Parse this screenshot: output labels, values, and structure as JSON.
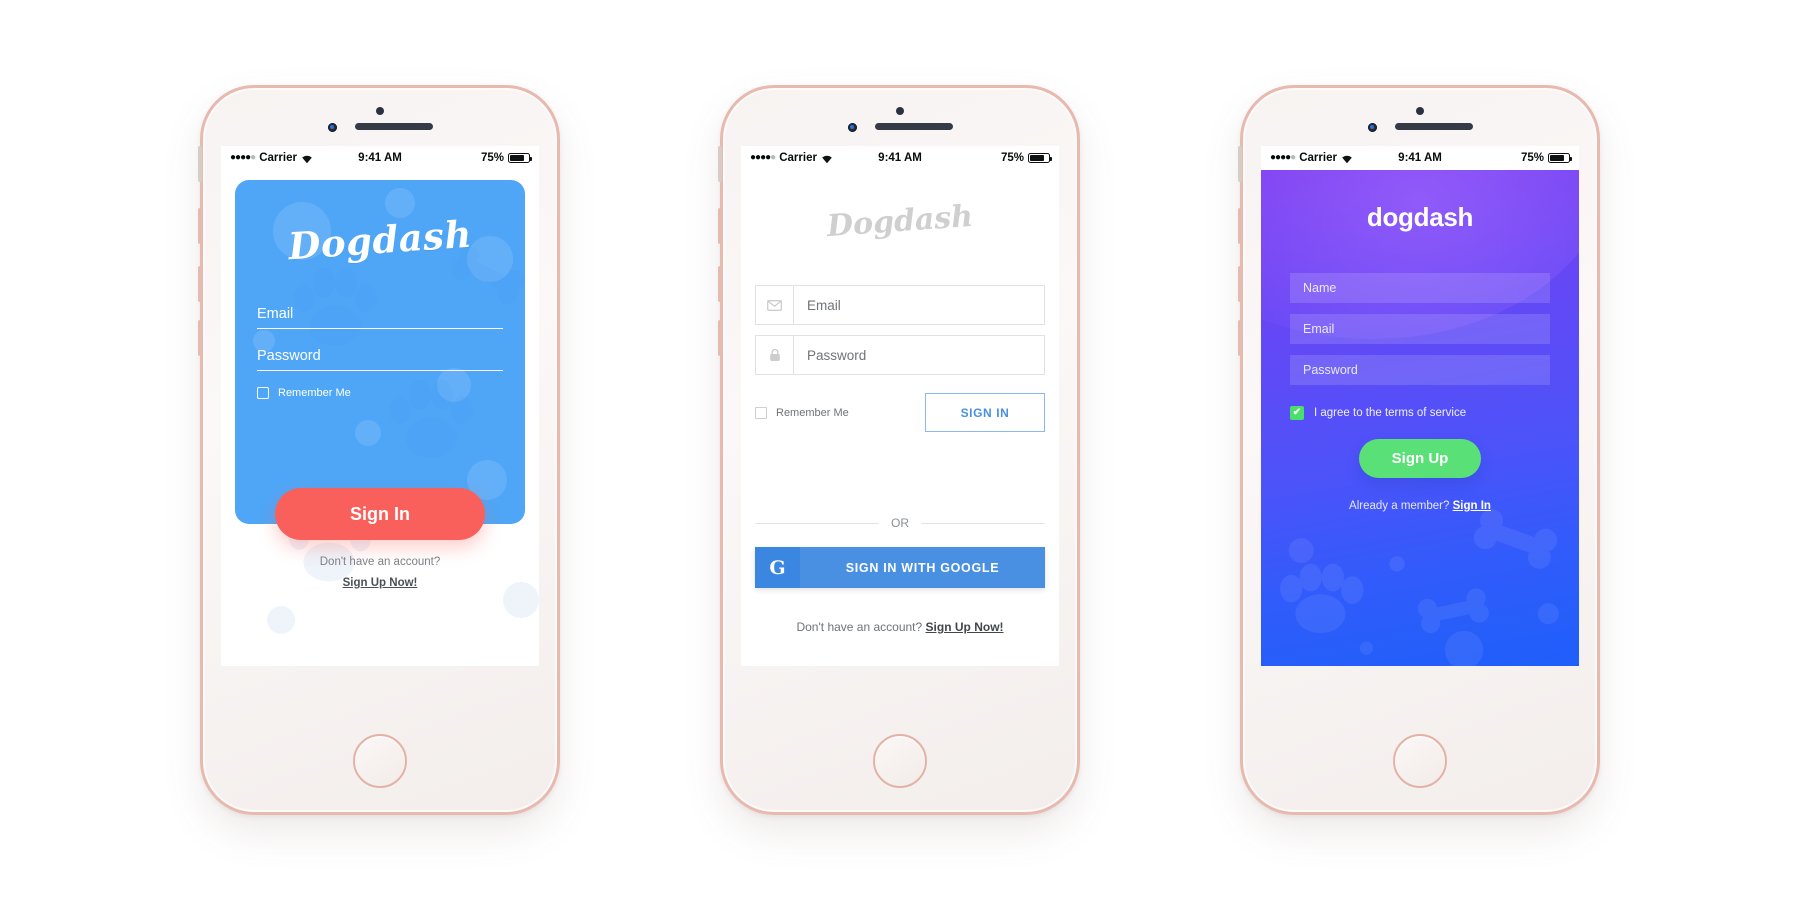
{
  "status_bar": {
    "carrier": "Carrier",
    "time": "9:41 AM",
    "battery": "75%",
    "signal_dots_filled": 4,
    "signal_dots_hollow": 1,
    "wifi_icon": "wifi-icon",
    "battery_icon": "battery-icon"
  },
  "screen1": {
    "logo": "Dogdash",
    "email_placeholder": "Email",
    "password_placeholder": "Password",
    "remember_label": "Remember Me",
    "signin_button": "Sign In",
    "footer_prompt": "Don't have an account?",
    "footer_link": "Sign Up Now!",
    "colors": {
      "card": "#4fa6f7",
      "button": "#f9605b",
      "text": "#ffffff",
      "footer_text": "#7c8288"
    }
  },
  "screen2": {
    "logo": "Dogdash",
    "email_placeholder": "Email",
    "email_icon": "envelope-icon",
    "password_placeholder": "Password",
    "password_icon": "lock-icon",
    "remember_label": "Remember Me",
    "signin_button": "SIGN IN",
    "divider_label": "OR",
    "google_icon": "google-g-icon",
    "google_button": "SIGN IN WITH GOOGLE",
    "footer_prompt": "Don't have an account?",
    "footer_link": "Sign Up Now!",
    "colors": {
      "background": "#ffffff",
      "logo": "#cfcfcf",
      "accent": "#4a90e2",
      "border": "#e2e2e2"
    }
  },
  "screen3": {
    "logo": "dogdash",
    "name_placeholder": "Name",
    "email_placeholder": "Email",
    "password_placeholder": "Password",
    "terms_label": "I agree to the terms of service",
    "terms_checked": true,
    "check_glyph": "✔",
    "signup_button": "Sign Up",
    "footer_prompt": "Already a member?",
    "footer_link": "Sign In",
    "colors": {
      "gradient_start": "#7a3cf0",
      "gradient_end": "#1f5ff9",
      "checkbox": "#4ade6a",
      "button": "#59e076",
      "text": "#ffffff"
    }
  }
}
